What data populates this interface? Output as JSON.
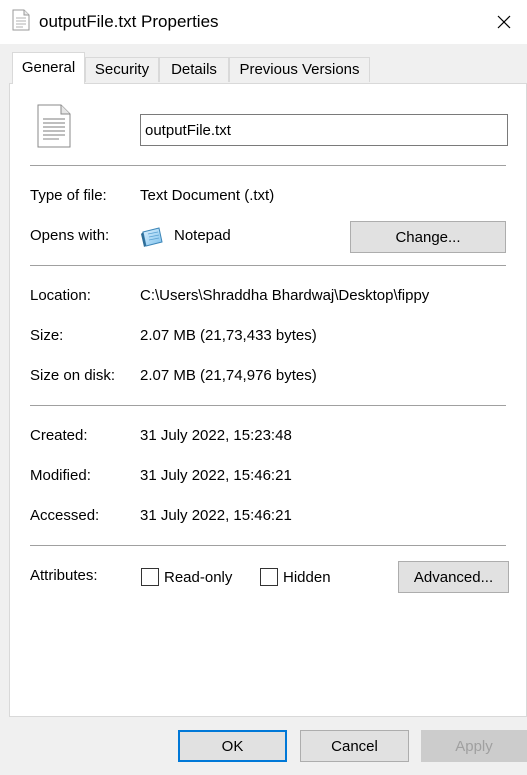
{
  "window": {
    "title": "outputFile.txt Properties",
    "close_icon": "close-icon"
  },
  "tabs": [
    {
      "label": "General",
      "active": true
    },
    {
      "label": "Security",
      "active": false
    },
    {
      "label": "Details",
      "active": false
    },
    {
      "label": "Previous Versions",
      "active": false
    }
  ],
  "general": {
    "file_icon": "text-file-icon",
    "file_name": "outputFile.txt",
    "type_label": "Type of file:",
    "type_value": "Text Document (.txt)",
    "opens_label": "Opens with:",
    "opens_app": "Notepad",
    "opens_app_icon": "notepad-icon",
    "change_button": "Change...",
    "location_label": "Location:",
    "location_value": "C:\\Users\\Shraddha Bhardwaj\\Desktop\\fippy",
    "size_label": "Size:",
    "size_value": "2.07 MB (21,73,433 bytes)",
    "size_disk_label": "Size on disk:",
    "size_disk_value": "2.07 MB (21,74,976 bytes)",
    "created_label": "Created:",
    "created_value": "31 July 2022, 15:23:48",
    "modified_label": "Modified:",
    "modified_value": "31 July 2022, 15:46:21",
    "accessed_label": "Accessed:",
    "accessed_value": "31 July 2022, 15:46:21",
    "attributes_label": "Attributes:",
    "readonly_label": "Read-only",
    "readonly_checked": false,
    "hidden_label": "Hidden",
    "hidden_checked": false,
    "advanced_button": "Advanced..."
  },
  "footer": {
    "ok": "OK",
    "cancel": "Cancel",
    "apply": "Apply",
    "apply_disabled": true
  },
  "colors": {
    "focus_accent": "#0078d7",
    "button_bg": "#e1e1e1",
    "disabled_text": "#a0a0a0"
  }
}
